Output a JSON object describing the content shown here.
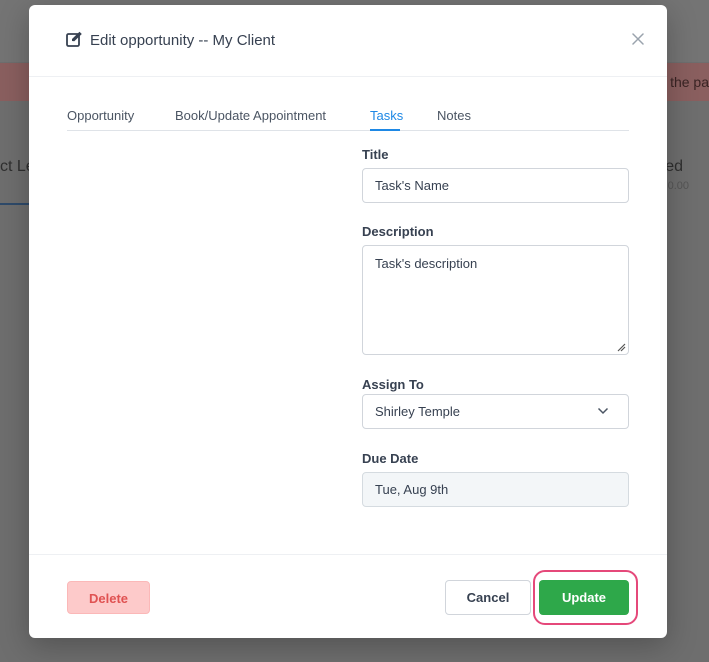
{
  "background": {
    "banner_text": "the pa",
    "stage_left_text": "ct Le",
    "stage_right_text": "ed",
    "stage_right_amount": "0.00"
  },
  "modal": {
    "title": "Edit opportunity -- My Client"
  },
  "tabs": [
    {
      "label": "Opportunity",
      "active": false
    },
    {
      "label": "Book/Update Appointment",
      "active": false
    },
    {
      "label": "Tasks",
      "active": true
    },
    {
      "label": "Notes",
      "active": false
    }
  ],
  "form": {
    "title_label": "Title",
    "title_value": "Task's Name",
    "description_label": "Description",
    "description_value": "Task's description",
    "assign_label": "Assign To",
    "assign_value": "Shirley Temple",
    "due_label": "Due Date",
    "due_value": "Tue, Aug 9th"
  },
  "footer": {
    "delete_label": "Delete",
    "cancel_label": "Cancel",
    "update_label": "Update"
  },
  "colors": {
    "accent_tab": "#1e88e5",
    "update_button": "#2ea84a",
    "delete_button_bg": "#fdcaca",
    "highlight_ring": "#e5487a"
  }
}
